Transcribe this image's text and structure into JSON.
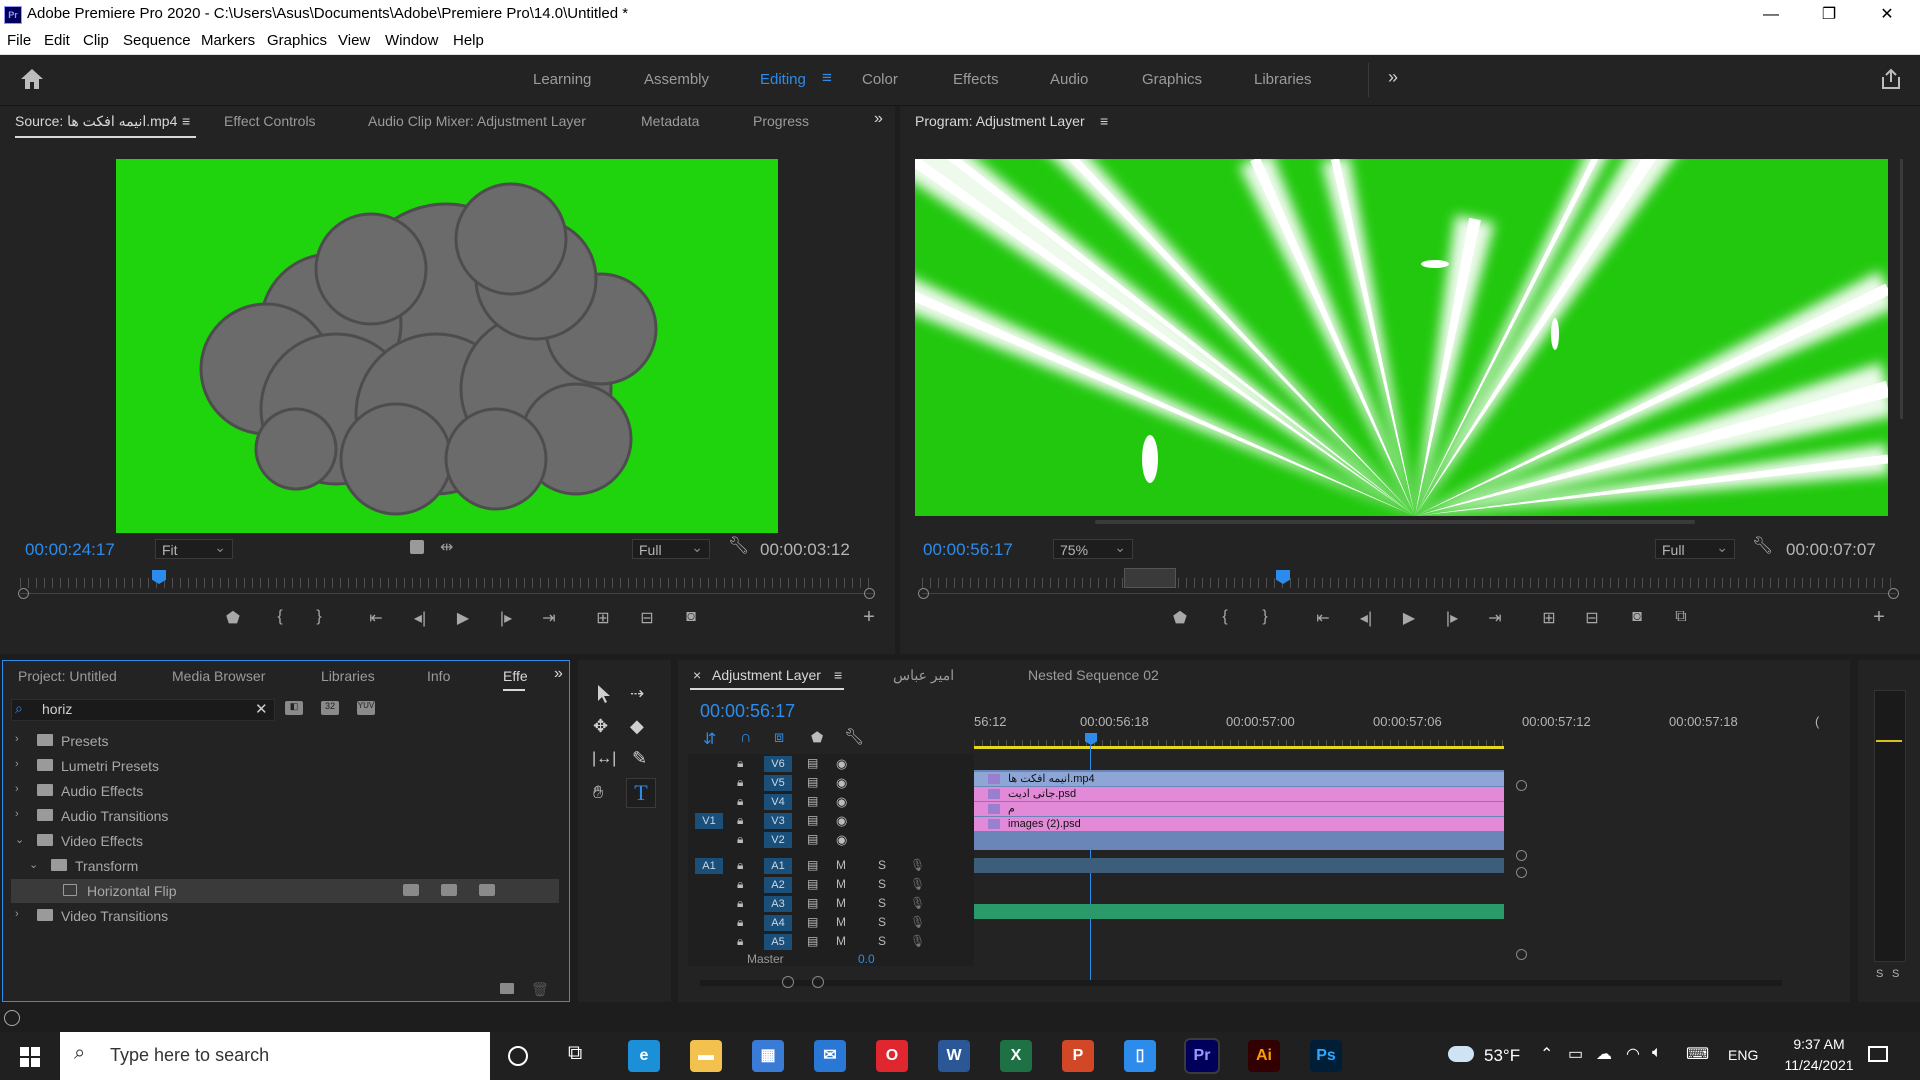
{
  "titlebar": {
    "title": "Adobe Premiere Pro 2020 - C:\\Users\\Asus\\Documents\\Adobe\\Premiere Pro\\14.0\\Untitled *",
    "logo": "Pr"
  },
  "menu": [
    "File",
    "Edit",
    "Clip",
    "Sequence",
    "Markers",
    "Graphics",
    "View",
    "Window",
    "Help"
  ],
  "workspaces": [
    "Learning",
    "Assembly",
    "Editing",
    "Color",
    "Effects",
    "Audio",
    "Graphics",
    "Libraries"
  ],
  "active_workspace": "Editing",
  "source": {
    "tabs": [
      "Source: انیمه افکت ها.mp4",
      "Effect Controls",
      "Audio Clip Mixer: Adjustment Layer",
      "Metadata",
      "Progress"
    ],
    "timecode": "00:00:24:17",
    "fit": "Fit",
    "quality": "Full",
    "duration": "00:00:03:12",
    "preview_bg": "#1fd40d",
    "smoke_color": "#6b6b6b"
  },
  "program": {
    "title": "Program: Adjustment Layer",
    "timecode": "00:00:56:17",
    "zoom": "75%",
    "quality": "Full",
    "duration": "00:00:07:07",
    "preview_bg": "#22c80e"
  },
  "project": {
    "tabs": [
      "Project: Untitled",
      "Media Browser",
      "Libraries",
      "Info",
      "Effe"
    ],
    "search_value": "horiz",
    "tree": [
      {
        "label": "Presets",
        "level": 0,
        "type": "preset",
        "open": false
      },
      {
        "label": "Lumetri Presets",
        "level": 0,
        "type": "preset",
        "open": false
      },
      {
        "label": "Audio Effects",
        "level": 0,
        "type": "folder",
        "open": false
      },
      {
        "label": "Audio Transitions",
        "level": 0,
        "type": "folder",
        "open": false
      },
      {
        "label": "Video Effects",
        "level": 0,
        "type": "folder",
        "open": true
      },
      {
        "label": "Transform",
        "level": 1,
        "type": "folder",
        "open": true
      },
      {
        "label": "Horizontal Flip",
        "level": 2,
        "type": "effect",
        "open": false
      },
      {
        "label": "Video Transitions",
        "level": 0,
        "type": "folder",
        "open": false
      }
    ]
  },
  "timeline": {
    "tabs": [
      "Adjustment Layer",
      "امیر عباس",
      "Nested Sequence 02"
    ],
    "timecode": "00:00:56:17",
    "ruler_labels": [
      "56:12",
      "00:00:56:18",
      "00:00:57:00",
      "00:00:57:06",
      "00:00:57:12",
      "00:00:57:18",
      "("
    ],
    "video_tracks": [
      "V6",
      "V5",
      "V4",
      "V3",
      "V2"
    ],
    "audio_tracks": [
      "A1",
      "A2",
      "A3",
      "A4",
      "A5"
    ],
    "master_label": "Master",
    "master_value": "0.0",
    "v1_label": "V1",
    "a1_label": "A1",
    "m_label": "M",
    "s_label": "S",
    "clips": [
      {
        "label": "انیمه افکت ها.mp4",
        "color": "#8da6d6"
      },
      {
        "label": "جاتی ادیت.psd",
        "color": "#e28ad8"
      },
      {
        "label": "م",
        "color": "#e28ad8"
      },
      {
        "label": "images (2).psd",
        "color": "#e28ad8"
      }
    ]
  },
  "meters": {
    "labels": [
      "S",
      "S"
    ]
  },
  "taskbar": {
    "search_placeholder": "Type here to search",
    "weather": "53°F",
    "lang": "ENG",
    "time": "9:37 AM",
    "date": "11/24/2021",
    "apps": [
      {
        "name": "edge",
        "text": "e",
        "color": "#1b8fd8"
      },
      {
        "name": "explorer",
        "text": "▬",
        "color": "#f2c14e"
      },
      {
        "name": "store",
        "text": "▦",
        "color": "#3a7bd5"
      },
      {
        "name": "mail",
        "text": "✉",
        "color": "#2a78d6"
      },
      {
        "name": "opera",
        "text": "O",
        "color": "#e0262f"
      },
      {
        "name": "word",
        "text": "W",
        "color": "#2b5797"
      },
      {
        "name": "excel",
        "text": "X",
        "color": "#1e7145"
      },
      {
        "name": "powerpoint",
        "text": "P",
        "color": "#d24726"
      },
      {
        "name": "phone",
        "text": "▯",
        "color": "#2d8ceb"
      },
      {
        "name": "premiere",
        "text": "Pr",
        "color": "#00005b"
      },
      {
        "name": "illustrator",
        "text": "Ai",
        "color": "#330000"
      },
      {
        "name": "photoshop",
        "text": "Ps",
        "color": "#001e36"
      }
    ]
  }
}
